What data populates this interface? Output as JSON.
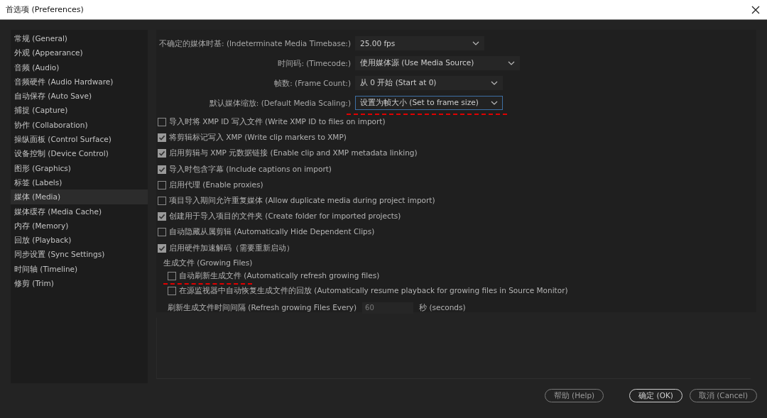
{
  "window": {
    "title": "首选项 (Preferences)"
  },
  "sidebar": {
    "items": [
      {
        "label": "常规 (General)",
        "selected": false
      },
      {
        "label": "外观 (Appearance)",
        "selected": false
      },
      {
        "label": "音频 (Audio)",
        "selected": false
      },
      {
        "label": "音频硬件 (Audio Hardware)",
        "selected": false
      },
      {
        "label": "自动保存 (Auto Save)",
        "selected": false
      },
      {
        "label": "捕捉 (Capture)",
        "selected": false
      },
      {
        "label": "协作 (Collaboration)",
        "selected": false
      },
      {
        "label": "操纵面板 (Control Surface)",
        "selected": false
      },
      {
        "label": "设备控制 (Device Control)",
        "selected": false
      },
      {
        "label": "图形 (Graphics)",
        "selected": false
      },
      {
        "label": "标签 (Labels)",
        "selected": false
      },
      {
        "label": "媒体 (Media)",
        "selected": true
      },
      {
        "label": "媒体缓存 (Media Cache)",
        "selected": false
      },
      {
        "label": "内存 (Memory)",
        "selected": false
      },
      {
        "label": "回放 (Playback)",
        "selected": false
      },
      {
        "label": "同步设置 (Sync Settings)",
        "selected": false
      },
      {
        "label": "时间轴 (Timeline)",
        "selected": false
      },
      {
        "label": "修剪 (Trim)",
        "selected": false
      }
    ]
  },
  "dropdowns": [
    {
      "label": "不确定的媒体时基: (Indeterminate Media Timebase:)",
      "value": "25.00 fps",
      "focused": false,
      "marked": false
    },
    {
      "label": "时间码: (Timecode:)",
      "value": "使用媒体源 (Use Media Source)",
      "focused": false,
      "marked": false
    },
    {
      "label": "帧数: (Frame Count:)",
      "value": "从 0 开始 (Start at 0)",
      "focused": false,
      "marked": false
    },
    {
      "label": "默认媒体缩放: (Default Media Scaling:)",
      "value": "设置为帧大小 (Set to frame size)",
      "focused": true,
      "marked": true
    }
  ],
  "checkboxes": [
    {
      "label": "导入时将 XMP ID 写入文件 (Write XMP ID to files on import)",
      "checked": false
    },
    {
      "label": "将剪辑标记写入 XMP (Write clip markers to XMP)",
      "checked": true
    },
    {
      "label": "启用剪辑与 XMP 元数据链接 (Enable clip and XMP metadata linking)",
      "checked": true
    },
    {
      "label": "导入时包含字幕 (Include captions on import)",
      "checked": true
    },
    {
      "label": "启用代理 (Enable proxies)",
      "checked": false
    },
    {
      "label": "项目导入期间允许重复媒体 (Allow duplicate media during project import)",
      "checked": false
    },
    {
      "label": "创建用于导入项目的文件夹 (Create folder for imported projects)",
      "checked": true
    },
    {
      "label": "自动隐藏从属剪辑 (Automatically Hide Dependent Clips)",
      "checked": false
    },
    {
      "label": "启用硬件加速解码（需要重新启动）",
      "checked": true
    }
  ],
  "growing_files": {
    "title": "生成文件 (Growing Files)",
    "checkboxes": [
      {
        "label": "自动刷新生成文件 (Automatically refresh growing files)",
        "checked": false,
        "marked": true
      },
      {
        "label": "在源监视器中自动恢复生成文件的回放 (Automatically resume playback for growing files in Source Monitor)",
        "checked": false,
        "marked": false
      }
    ],
    "interval": {
      "label": "刷新生成文件时间间隔 (Refresh growing Files Every)",
      "value": "60",
      "unit": "秒 (seconds)",
      "disabled": true
    }
  },
  "buttons": [
    {
      "label": "帮助 (Help)",
      "kind": "plain"
    },
    {
      "label": "确定 (OK)",
      "kind": "default"
    },
    {
      "label": "取消 (Cancel)",
      "kind": "plain"
    }
  ]
}
